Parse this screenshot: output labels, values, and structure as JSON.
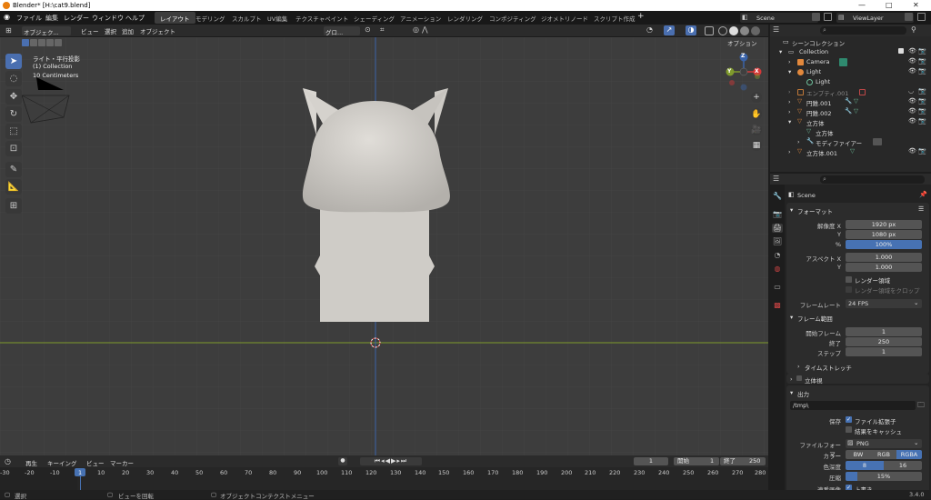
{
  "window": {
    "title": "Blender* [H:\\cat9.blend]",
    "controls": [
      "—",
      "□",
      "✕"
    ]
  },
  "menubar": {
    "menus": [
      "ファイル",
      "編集",
      "レンダー",
      "ウィンドウ",
      "ヘルプ"
    ],
    "workspaces": [
      "レイアウト",
      "モデリング",
      "スカルプト",
      "UV編集",
      "テクスチャペイント",
      "シェーディング",
      "アニメーション",
      "レンダリング",
      "コンポジティング",
      "ジオメトリノード",
      "スクリプト作成"
    ],
    "add_tab": "+",
    "scene": "Scene",
    "viewlayer": "ViewLayer"
  },
  "viewport_header": {
    "mode": "オブジェク...",
    "menus": [
      "ビュー",
      "選択",
      "追加",
      "オブジェクト"
    ],
    "transform": "グロ...",
    "options": "オプション"
  },
  "overlay": {
    "line1": "ライト・平行投影",
    "line2": "(1) Collection",
    "line3": "10 Centimeters"
  },
  "gizmo": {
    "z": "Z",
    "y": "Y",
    "x": "X"
  },
  "outliner": {
    "title": "シーンコレクション",
    "items": [
      {
        "label": "Collection"
      },
      {
        "label": "Camera"
      },
      {
        "label": "Light"
      },
      {
        "label": "Light"
      },
      {
        "label": "エンプティ.001"
      },
      {
        "label": "円錐.001"
      },
      {
        "label": "円錐.002"
      },
      {
        "label": "立方体"
      },
      {
        "label": "立方体"
      },
      {
        "label": "モディファイアー"
      },
      {
        "label": "立方体.001"
      }
    ]
  },
  "properties": {
    "scene_label": "Scene",
    "format": {
      "header": "フォーマット",
      "res_x_label": "解像度 X",
      "res_x": "1920 px",
      "res_y_label": "Y",
      "res_y": "1080 px",
      "pct_label": "%",
      "pct": "100%",
      "asp_x_label": "アスペクト X",
      "asp_x": "1.000",
      "asp_y_label": "Y",
      "asp_y": "1.000",
      "render_region": "レンダー領域",
      "crop": "レンダー領域をクロップ",
      "fps_label": "フレームレート",
      "fps": "24 FPS"
    },
    "frame_range": {
      "header": "フレーム範囲",
      "start_label": "開始フレーム",
      "start": "1",
      "end_label": "終了",
      "end": "250",
      "step_label": "ステップ",
      "step": "1",
      "time_stretch": "タイムストレッチ"
    },
    "stereo": "立体視",
    "output": {
      "header": "出力",
      "path": "/tmp\\",
      "save_label": "保存",
      "file_ext": "ファイル拡張子",
      "cache": "結果をキャッシュ",
      "format_label": "ファイルフォーマ...",
      "format": "PNG",
      "color_label": "カラー",
      "bw": "BW",
      "rgb": "RGB",
      "rgba": "RGBA",
      "depth_label": "色深度",
      "depth8": "8",
      "depth16": "16",
      "compression_label": "圧縮",
      "compression": "15%",
      "seq_label": "連番画像",
      "overwrite": "上書き"
    }
  },
  "timeline": {
    "menus": [
      "再生",
      "キーイング",
      "ビュー",
      "マーカー"
    ],
    "current_frame": "1",
    "start_label": "開始",
    "start": "1",
    "end_label": "終了",
    "end": "250",
    "ticks": [
      "-30",
      "-20",
      "-10",
      "1",
      "10",
      "20",
      "30",
      "40",
      "50",
      "60",
      "70",
      "80",
      "90",
      "100",
      "110",
      "120",
      "130",
      "140",
      "150",
      "160",
      "170",
      "180",
      "190",
      "200",
      "210",
      "220",
      "230",
      "240",
      "250",
      "260",
      "270",
      "280"
    ]
  },
  "statusbar": {
    "select": "選択",
    "rotate": "ビューを回転",
    "context": "オブジェクトコンテクストメニュー",
    "version": "3.4.0"
  }
}
